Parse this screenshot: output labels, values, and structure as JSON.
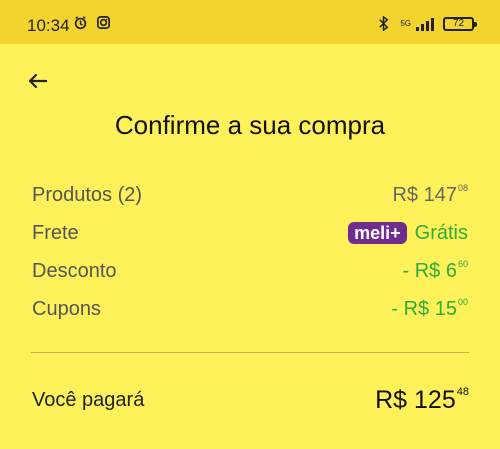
{
  "status_bar": {
    "time": "10:34",
    "network": "5G",
    "battery": "72",
    "icons": [
      "alarm-icon",
      "instagram-icon",
      "bluetooth-icon",
      "signal-icon",
      "battery-icon"
    ]
  },
  "header": {
    "back_icon": "arrow-left-icon",
    "title": "Confirme a sua compra"
  },
  "summary": {
    "products": {
      "label": "Produtos (2)",
      "currency": "R$",
      "integer": "147",
      "cents": "08"
    },
    "shipping": {
      "label": "Frete",
      "badge": "meli+",
      "value": "Grátis"
    },
    "discount": {
      "label": "Desconto",
      "prefix": "- R$",
      "integer": "6",
      "cents": "60"
    },
    "coupons": {
      "label": "Cupons",
      "prefix": "- R$",
      "integer": "15",
      "cents": "00"
    }
  },
  "total": {
    "label": "Você pagará",
    "currency": "R$",
    "integer": "125",
    "cents": "48"
  },
  "colors": {
    "background": "#FFF159",
    "status_bar": "#F3D42E",
    "green": "#2BAE3A",
    "meli_badge": "#6F2D8F"
  }
}
